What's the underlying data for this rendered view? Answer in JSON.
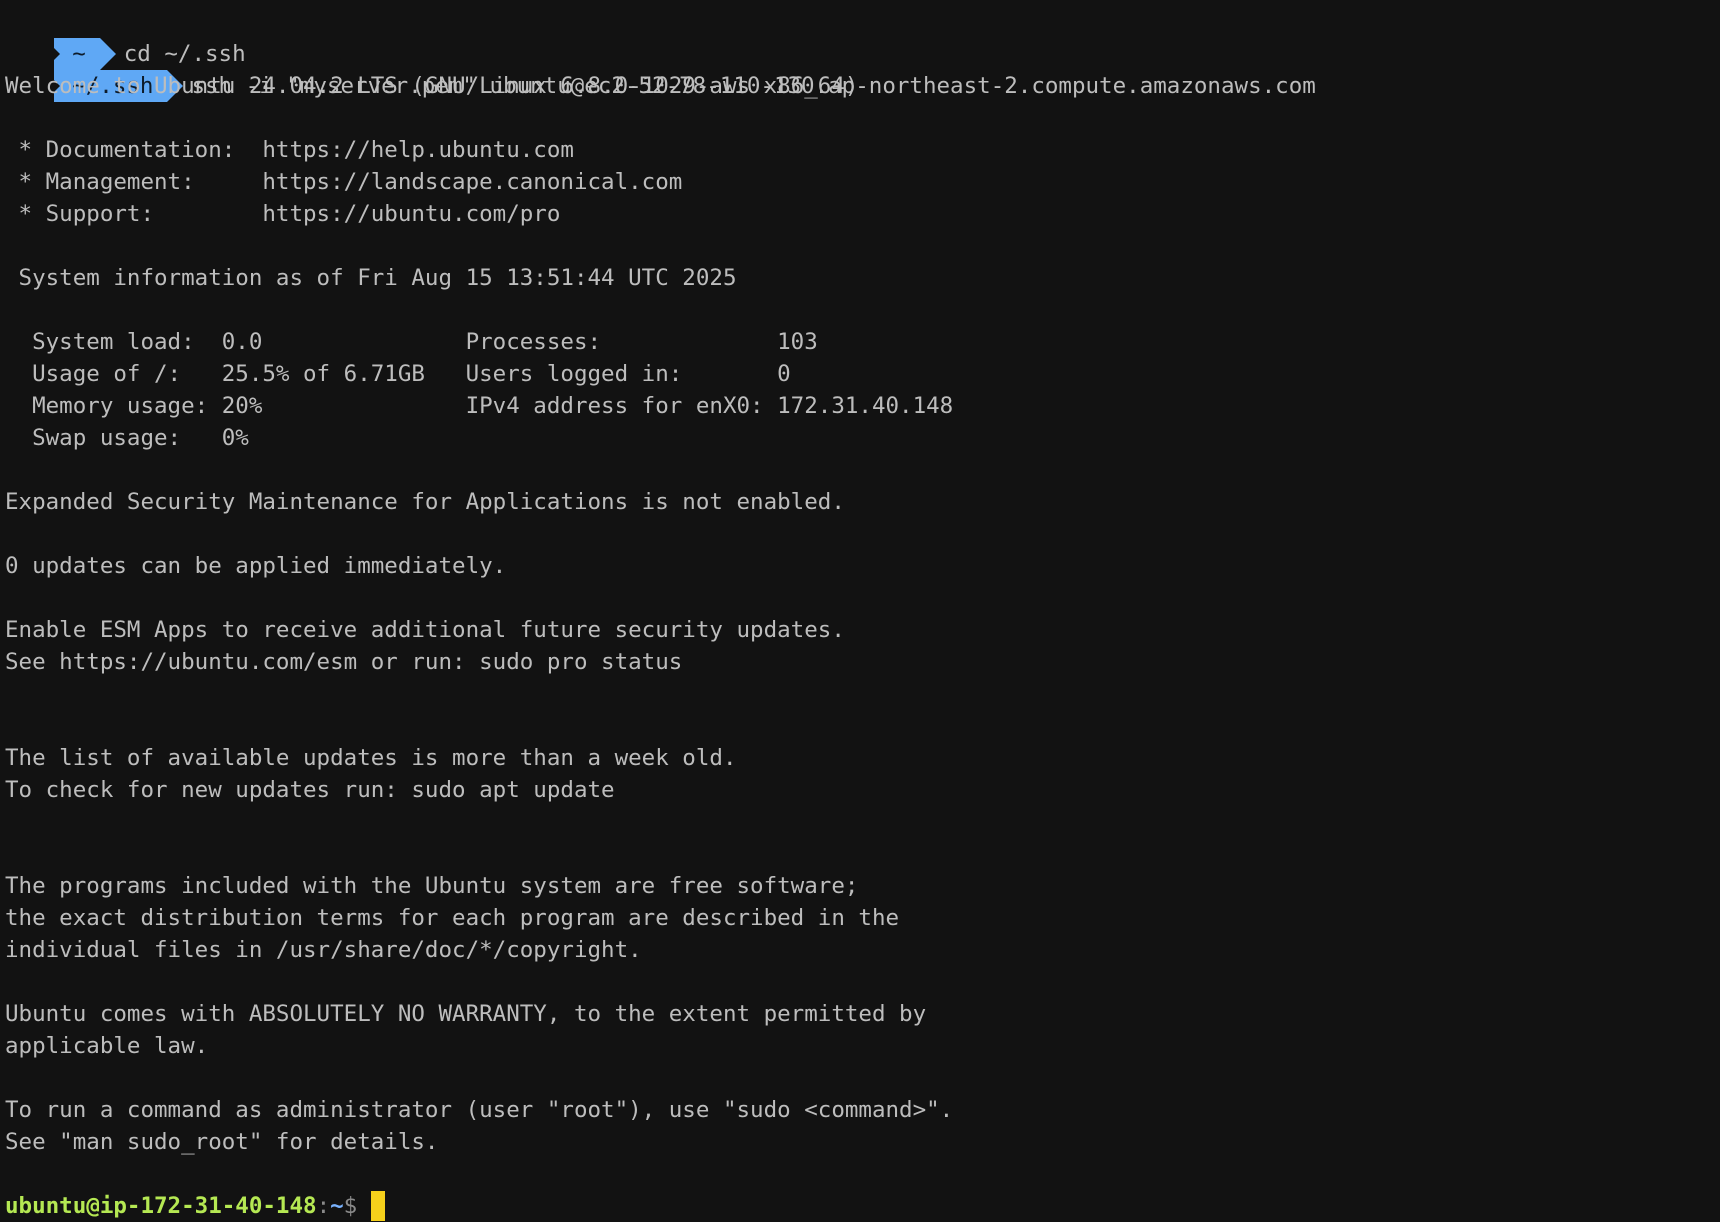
{
  "segments": {
    "home": "~",
    "ssh_dir": "~/.ssh"
  },
  "commands": {
    "cd": "cd ~/.ssh",
    "ssh": "ssh -i \"myserver.pem\" ubuntu@ec2-52-78-110-130.ap-northeast-2.compute.amazonaws.com"
  },
  "output": [
    "Welcome to Ubuntu 24.04.2 LTS (GNU/Linux 6.8.0-1029-aws x86_64)",
    "",
    " * Documentation:  https://help.ubuntu.com",
    " * Management:     https://landscape.canonical.com",
    " * Support:        https://ubuntu.com/pro",
    "",
    " System information as of Fri Aug 15 13:51:44 UTC 2025",
    "",
    "  System load:  0.0               Processes:             103",
    "  Usage of /:   25.5% of 6.71GB   Users logged in:       0",
    "  Memory usage: 20%               IPv4 address for enX0: 172.31.40.148",
    "  Swap usage:   0%",
    "",
    "Expanded Security Maintenance for Applications is not enabled.",
    "",
    "0 updates can be applied immediately.",
    "",
    "Enable ESM Apps to receive additional future security updates.",
    "See https://ubuntu.com/esm or run: sudo pro status",
    "",
    "",
    "The list of available updates is more than a week old.",
    "To check for new updates run: sudo apt update",
    "",
    "",
    "The programs included with the Ubuntu system are free software;",
    "the exact distribution terms for each program are described in the",
    "individual files in /usr/share/doc/*/copyright.",
    "",
    "Ubuntu comes with ABSOLUTELY NO WARRANTY, to the extent permitted by",
    "applicable law.",
    "",
    "To run a command as administrator (user \"root\"), use \"sudo <command>\".",
    "See \"man sudo_root\" for details.",
    ""
  ],
  "prompt": {
    "user_host": "ubuntu@ip-172-31-40-148",
    "sep": ":",
    "path": "~",
    "symbol": "$"
  },
  "colors": {
    "background": "#121212",
    "text": "#bdbdbd",
    "segment": "#5fa8f5",
    "prompt_user": "#b5e853",
    "prompt_path": "#7ab3ff",
    "cursor": "#f5d01b"
  }
}
